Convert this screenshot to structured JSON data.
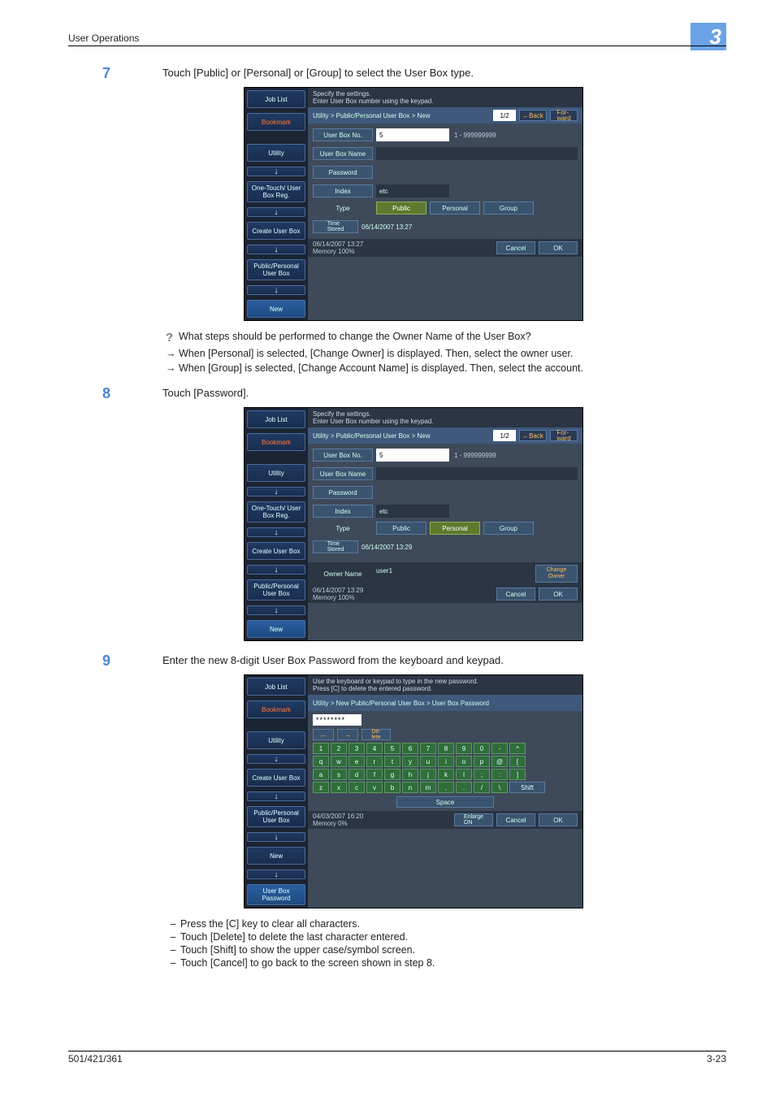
{
  "header": {
    "section": "User Operations",
    "chapter": "3"
  },
  "footer": {
    "left": "501/421/361",
    "right": "3-23"
  },
  "step7": {
    "num": "7",
    "text": "Touch [Public] or [Personal] or [Group] to select the User Box type.",
    "q": "What steps should be performed to change the Owner Name of the User Box?",
    "a1": "When [Personal] is selected, [Change Owner] is displayed. Then, select the owner user.",
    "a2": "When [Group] is selected, [Change Account Name] is displayed. Then, select the account."
  },
  "step8": {
    "num": "8",
    "text": "Touch [Password]."
  },
  "step9": {
    "num": "9",
    "text": "Enter the new 8-digit User Box Password from the keyboard and keypad.",
    "d1": "Press the [C] key to clear all characters.",
    "d2": "Touch [Delete] to delete the last character entered.",
    "d3": "Touch [Shift] to show the upper case/symbol screen.",
    "d4": "Touch [Cancel] to go back to the screen shown in step 8."
  },
  "side": {
    "job": "Job List",
    "bookmark": "Bookmark",
    "utility": "Utility",
    "onetouch": "One-Touch/\nUser Box Reg.",
    "create": "Create User Box",
    "pub": "Public/Personal\nUser Box",
    "new": "New",
    "password": "User Box\nPassword"
  },
  "panelA": {
    "msg": "Specify the settings.\nEnter User Box number using the keypad.",
    "crumb": "Utility > Public/Personal User Box > New",
    "page": "1/2",
    "back": "←Back",
    "fwd": "For-\nward",
    "no_lbl": "User Box No.",
    "no_val": "5",
    "range": "1 - 999999999",
    "name_lbl": "User Box Name",
    "pw_lbl": "Password",
    "index_lbl": "Index",
    "index_val": "etc",
    "type_lbl": "Type",
    "t_pub": "Public",
    "t_per": "Personal",
    "t_grp": "Group",
    "time_lbl": "Time\nStored",
    "time_val": "06/14/2007   13:27",
    "ts": "06/14/2007   13:27\nMemory        100%",
    "cancel": "Cancel",
    "ok": "OK"
  },
  "panelB": {
    "msg": "Specify the settings.\nEnter User Box number using the keypad.",
    "crumb": "Utility > Public/Personal User Box > New",
    "page": "1/2",
    "back": "←Back",
    "fwd": "For-\nward",
    "no_lbl": "User Box No.",
    "no_val": "5",
    "range": "1 - 999999999",
    "name_lbl": "User Box Name",
    "pw_lbl": "Password",
    "index_lbl": "Index",
    "index_val": "etc",
    "type_lbl": "Type",
    "t_pub": "Public",
    "t_per": "Personal",
    "t_grp": "Group",
    "time_lbl": "Time\nStored",
    "time_val": "06/14/2007   13:29",
    "owner_lbl": "Owner Name",
    "owner_val": "user1",
    "change": "Change\nOwner",
    "ts": "06/14/2007   13:29\nMemory        100%",
    "cancel": "Cancel",
    "ok": "OK"
  },
  "panelC": {
    "msg": "Use the keyboard or keypad to type in the new password.\nPress [C] to delete the entered password.",
    "crumb": "Utility > New Public/Personal User Box > User Box Password",
    "dots": "********",
    "left": "←",
    "right": "→",
    "del": "De-\nlete",
    "r1": [
      "1",
      "2",
      "3",
      "4",
      "5",
      "6",
      "7",
      "8",
      "9",
      "0",
      "-",
      "^"
    ],
    "r2": [
      "q",
      "w",
      "e",
      "r",
      "t",
      "y",
      "u",
      "i",
      "o",
      "p",
      "@",
      "["
    ],
    "r3": [
      "a",
      "s",
      "d",
      "f",
      "g",
      "h",
      "j",
      "k",
      "l",
      ";",
      ":",
      "]"
    ],
    "r4": [
      "z",
      "x",
      "c",
      "v",
      "b",
      "n",
      "m",
      ",",
      ".",
      "/",
      "\\"
    ],
    "shift": "Shift",
    "space": "Space",
    "ts": "04/03/2007   16:20\nMemory          0%",
    "enlarge": "Enlarge\nON",
    "cancel": "Cancel",
    "ok": "OK"
  }
}
